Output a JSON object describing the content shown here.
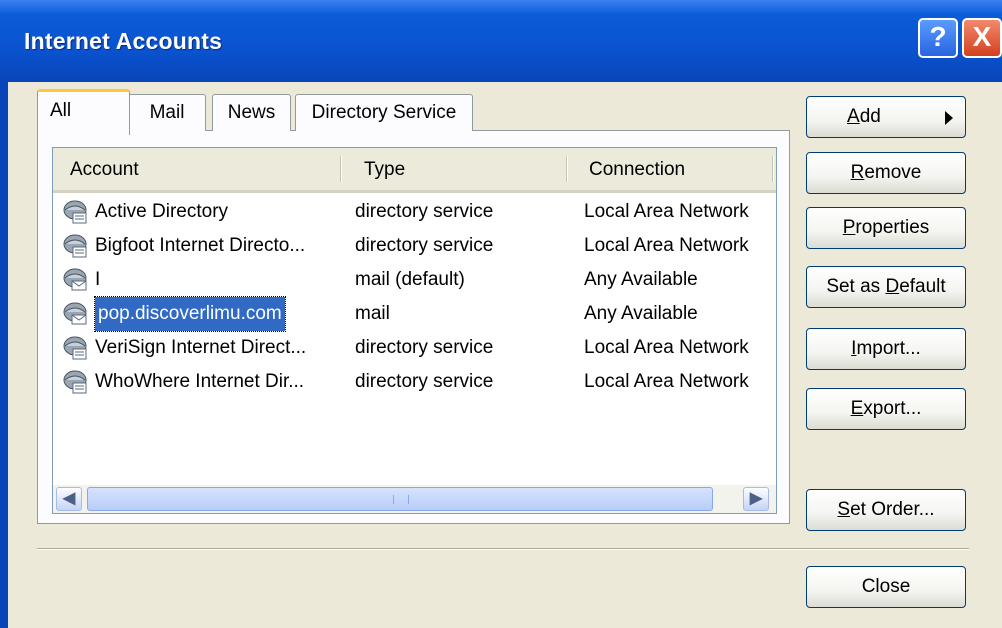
{
  "window": {
    "title": "Internet Accounts",
    "help_label": "?",
    "close_label": "X"
  },
  "tabs": [
    {
      "label": "All"
    },
    {
      "label": "Mail"
    },
    {
      "label": "News"
    },
    {
      "label": "Directory Service"
    }
  ],
  "list": {
    "columns": [
      "Account",
      "Type",
      "Connection"
    ],
    "rows": [
      {
        "account": "Active Directory",
        "type": "directory service",
        "connection": "Local Area Network"
      },
      {
        "account": "Bigfoot Internet Directo...",
        "type": "directory service",
        "connection": "Local Area Network"
      },
      {
        "account": "I",
        "type": "mail (default)",
        "connection": "Any Available"
      },
      {
        "account": "pop.discoverlimu.com",
        "type": "mail",
        "connection": "Any Available"
      },
      {
        "account": "VeriSign Internet Direct...",
        "type": "directory service",
        "connection": "Local Area Network"
      },
      {
        "account": "WhoWhere Internet Dir...",
        "type": "directory service",
        "connection": "Local Area Network"
      }
    ],
    "selected_row": 3,
    "row_icons": [
      "directory-server-icon",
      "directory-server-icon",
      "mail-server-icon",
      "mail-server-icon",
      "directory-server-icon",
      "directory-server-icon"
    ]
  },
  "buttons": {
    "add": {
      "ul": "A",
      "rest": "dd"
    },
    "remove": {
      "ul": "R",
      "rest": "emove"
    },
    "properties": {
      "ul": "P",
      "rest": "roperties"
    },
    "set_default": {
      "pre": "Set as ",
      "ul": "D",
      "rest": "efault"
    },
    "import": {
      "ul": "I",
      "rest": "mport..."
    },
    "export": {
      "ul": "E",
      "rest": "xport..."
    },
    "set_order": {
      "ul": "S",
      "rest": "et Order..."
    },
    "close": {
      "label": "Close"
    }
  },
  "colors": {
    "title_bar": "#0a53d0",
    "selection": "#316ac5",
    "tab_highlight": "#ffc83c"
  }
}
